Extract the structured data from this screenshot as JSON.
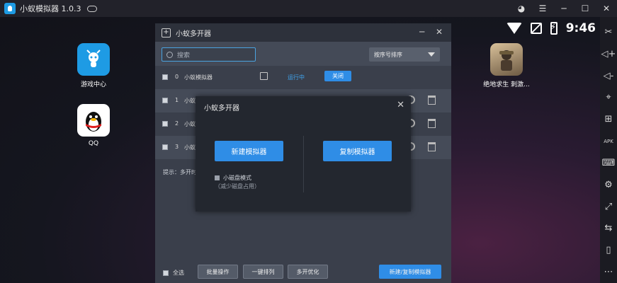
{
  "titlebar": {
    "app_title": "小蚁模拟器 1.0.3"
  },
  "statusbar": {
    "time": "9:46"
  },
  "desktop": {
    "apps": [
      {
        "label": "游戏中心"
      },
      {
        "label": "QQ"
      },
      {
        "label": "绝地求生 刺激..."
      }
    ]
  },
  "sidebar_tools": [
    "scissors-icon",
    "volume-up-icon",
    "volume-down-icon",
    "location-icon",
    "add-icon",
    "apk-icon",
    "keyboard-icon",
    "settings-icon",
    "fullscreen-icon",
    "sync-icon",
    "shake-icon",
    "more-icon"
  ],
  "multi_window": {
    "title": "小蚁多开器",
    "search_placeholder": "搜索",
    "sort_label": "按序号排序",
    "rows": [
      {
        "index": "0",
        "name": "小蚁模拟器",
        "status": "运行中",
        "action": "关闭"
      },
      {
        "index": "1",
        "name": "小蚁"
      },
      {
        "index": "2",
        "name": "小蚁"
      },
      {
        "index": "3",
        "name": "小蚁"
      }
    ],
    "hint": "提示：多开时",
    "footer": {
      "select_all": "全选",
      "batch": "批量操作",
      "arrange": "一键排列",
      "optimize": "多开优化",
      "new_copy": "新建/复制模拟器"
    }
  },
  "dialog": {
    "title": "小蚁多开器",
    "new_button": "新建模拟器",
    "copy_button": "复制模拟器",
    "small_disk_label": "小磁盘模式",
    "small_disk_note": "（减少磁盘占用）"
  },
  "colors": {
    "accent": "#2f8de6",
    "running": "#3fa5f0"
  }
}
